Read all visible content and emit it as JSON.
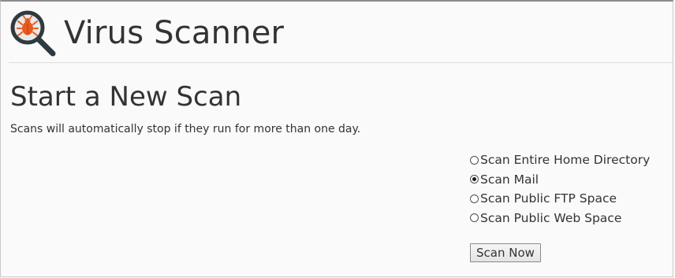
{
  "header": {
    "title": "Virus Scanner",
    "icon": "virus-scanner-icon"
  },
  "scan": {
    "heading": "Start a New Scan",
    "notice": "Scans will automatically stop if they run for more than one day.",
    "options": [
      {
        "label": "Scan Entire Home Directory",
        "checked": false
      },
      {
        "label": "Scan Mail",
        "checked": true
      },
      {
        "label": "Scan Public FTP Space",
        "checked": false
      },
      {
        "label": "Scan Public Web Space",
        "checked": false
      }
    ],
    "button_label": "Scan Now"
  },
  "colors": {
    "icon_orange": "#e8591e",
    "icon_dark": "#2f3a40",
    "text": "#333333"
  }
}
